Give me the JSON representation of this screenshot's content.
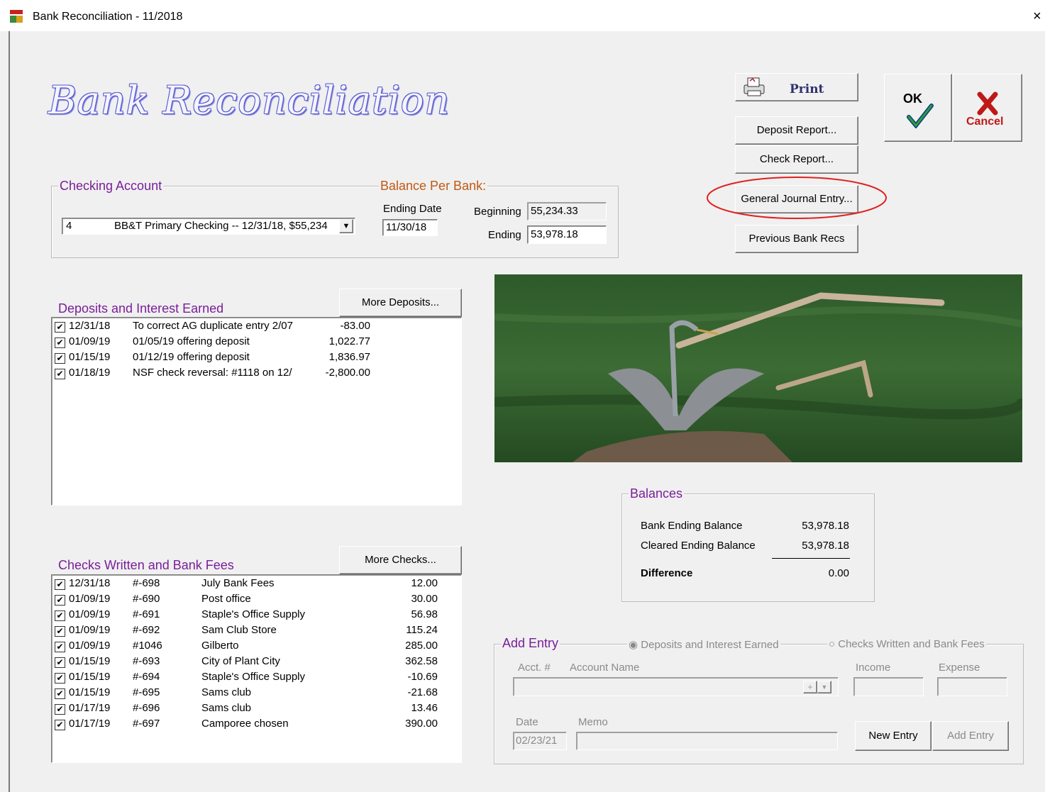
{
  "window": {
    "title": "Bank Reconciliation - 11/2018",
    "close": "×"
  },
  "heading": "Bank Reconciliation",
  "toolbar": {
    "print": "Print",
    "deposit_report": "Deposit Report...",
    "check_report": "Check Report...",
    "general_journal_entry": "General Journal Entry...",
    "previous_bank_recs": "Previous Bank Recs",
    "ok": "OK",
    "cancel": "Cancel"
  },
  "checking_account": {
    "legend": "Checking Account",
    "account_number": "4",
    "account_desc": "BB&T Primary Checking -- 12/31/18, $55,234"
  },
  "balance_per_bank": {
    "legend": "Balance Per Bank:",
    "ending_date_label": "Ending Date",
    "ending_date": "11/30/18",
    "beginning_label": "Beginning",
    "beginning": "55,234.33",
    "ending_label": "Ending",
    "ending": "53,978.18"
  },
  "deposits": {
    "title": "Deposits and Interest Earned",
    "more_button": "More Deposits...",
    "rows": [
      {
        "date": "12/31/18",
        "desc": "To correct AG duplicate entry 2/07",
        "amount": "-83.00"
      },
      {
        "date": "01/09/19",
        "desc": "01/05/19 offering deposit",
        "amount": "1,022.77"
      },
      {
        "date": "01/15/19",
        "desc": "01/12/19 offering deposit",
        "amount": "1,836.97"
      },
      {
        "date": "01/18/19",
        "desc": "NSF check reversal: #1118 on 12/",
        "amount": "-2,800.00"
      }
    ]
  },
  "checks": {
    "title": "Checks Written and Bank Fees",
    "more_button": "More Checks...",
    "rows": [
      {
        "date": "12/31/18",
        "num": "#-698",
        "payee": "July Bank Fees",
        "amount": "12.00"
      },
      {
        "date": "01/09/19",
        "num": "#-690",
        "payee": "Post office",
        "amount": "30.00"
      },
      {
        "date": "01/09/19",
        "num": "#-691",
        "payee": "Staple's Office Supply",
        "amount": "56.98"
      },
      {
        "date": "01/09/19",
        "num": "#-692",
        "payee": "Sam Club Store",
        "amount": "115.24"
      },
      {
        "date": "01/09/19",
        "num": "#1046",
        "payee": "Gilberto",
        "amount": "285.00"
      },
      {
        "date": "01/15/19",
        "num": "#-693",
        "payee": "City of Plant City",
        "amount": "362.58"
      },
      {
        "date": "01/15/19",
        "num": "#-694",
        "payee": "Staple's Office Supply",
        "amount": "-10.69"
      },
      {
        "date": "01/15/19",
        "num": "#-695",
        "payee": "Sams club",
        "amount": "-21.68"
      },
      {
        "date": "01/17/19",
        "num": "#-696",
        "payee": "Sams club",
        "amount": "13.46"
      },
      {
        "date": "01/17/19",
        "num": "#-697",
        "payee": "Camporee chosen",
        "amount": "390.00"
      }
    ]
  },
  "balances": {
    "legend": "Balances",
    "bank_ending_label": "Bank Ending Balance",
    "bank_ending": "53,978.18",
    "cleared_ending_label": "Cleared Ending Balance",
    "cleared_ending": "53,978.18",
    "difference_label": "Difference",
    "difference": "0.00"
  },
  "add_entry": {
    "legend": "Add Entry",
    "radio_deposits": "Deposits and Interest Earned",
    "radio_checks": "Checks Written and Bank Fees",
    "acct_label": "Acct. #",
    "account_name_label": "Account Name",
    "income_label": "Income",
    "expense_label": "Expense",
    "date_label": "Date",
    "date_value": "02/23/21",
    "memo_label": "Memo",
    "new_entry": "New Entry",
    "add_entry_btn": "Add Entry"
  },
  "colors": {
    "accent_purple": "#7a1e9a",
    "accent_orange": "#c05a14",
    "highlight_circle": "#e02020"
  }
}
